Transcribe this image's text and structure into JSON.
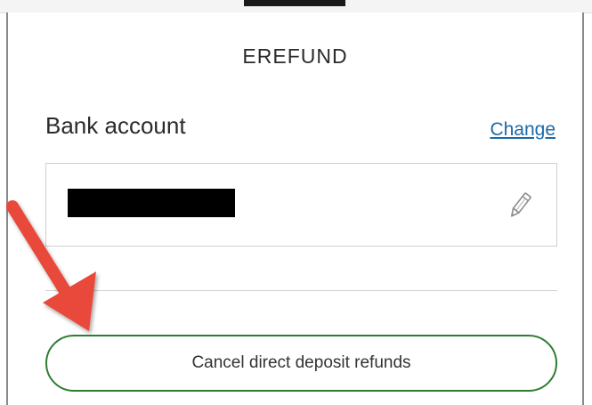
{
  "card": {
    "title": "EREFUND"
  },
  "bank_account": {
    "label": "Bank account",
    "change_link": "Change",
    "edit_icon": "pencil-icon",
    "account_value_redacted": true
  },
  "actions": {
    "cancel_label": "Cancel direct deposit refunds"
  },
  "colors": {
    "button_border": "#2e7d32",
    "link": "#1d6aa8",
    "annotation_arrow": "#e8483b"
  }
}
